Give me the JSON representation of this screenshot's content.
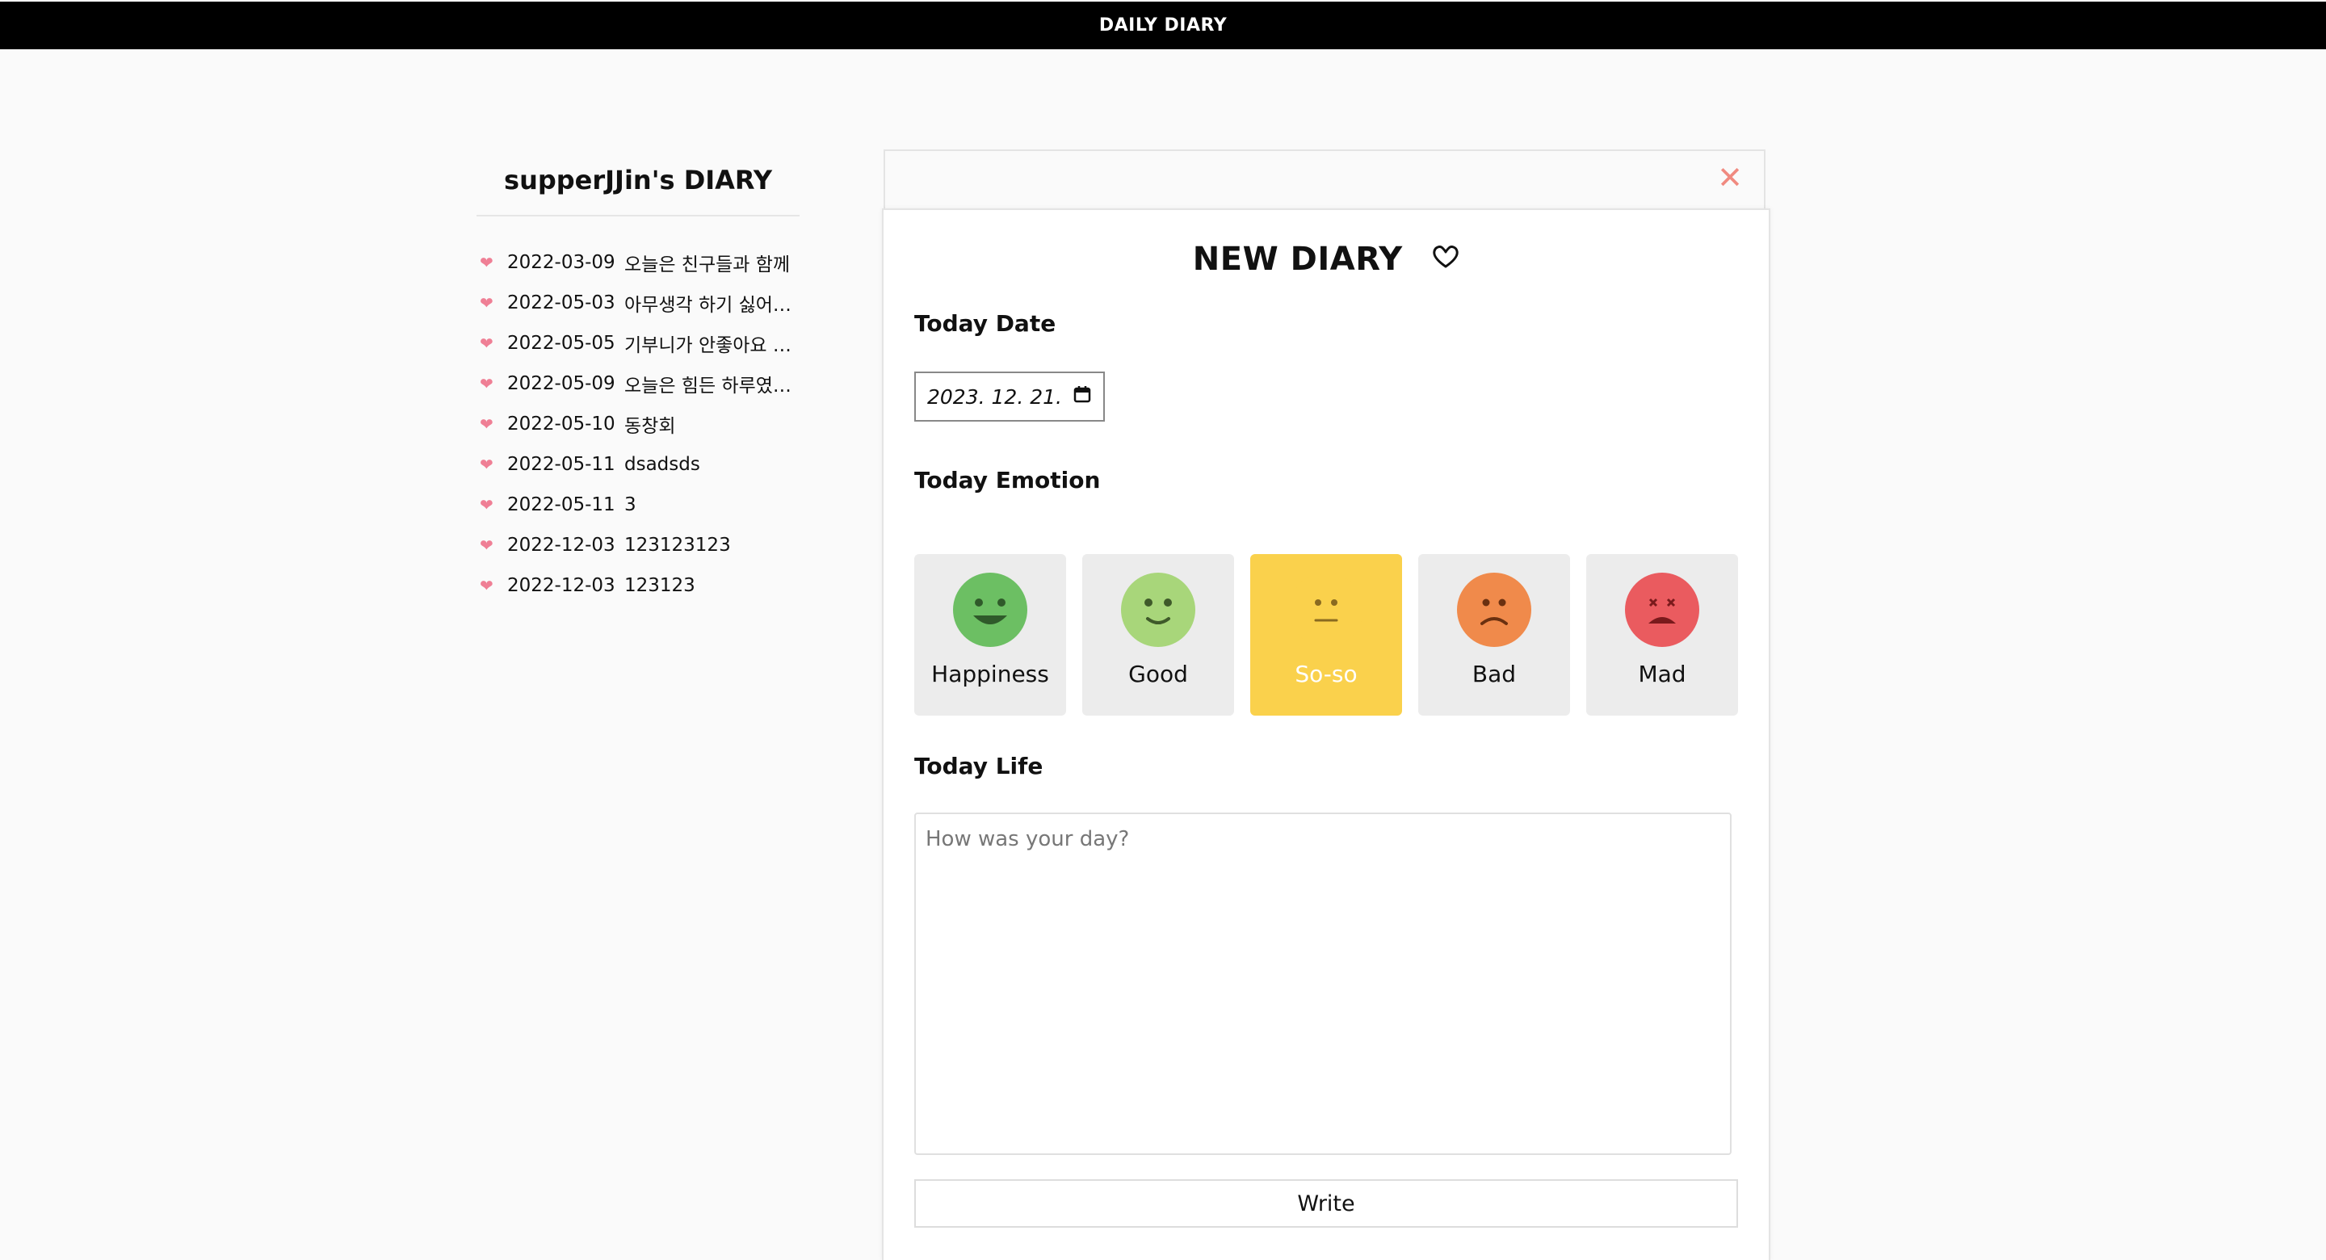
{
  "header": {
    "title": "DAILY DIARY"
  },
  "sidebar": {
    "title": "supperJJin's DIARY",
    "entries": [
      {
        "date": "2022-03-09",
        "text": "오늘은 친구들과 함께"
      },
      {
        "date": "2022-05-03",
        "text": "아무생각 하기 싫어…"
      },
      {
        "date": "2022-05-05",
        "text": "기부니가 안좋아요 …"
      },
      {
        "date": "2022-05-09",
        "text": "오늘은 힘든 하루였…"
      },
      {
        "date": "2022-05-10",
        "text": "동창회"
      },
      {
        "date": "2022-05-11",
        "text": "dsadsds"
      },
      {
        "date": "2022-05-11",
        "text": "3"
      },
      {
        "date": "2022-12-03",
        "text": "123123123"
      },
      {
        "date": "2022-12-03",
        "text": "123123"
      }
    ]
  },
  "modal": {
    "title": "NEW DIARY",
    "date_label": "Today Date",
    "date_value": "2023. 12. 21.",
    "emotion_label": "Today Emotion",
    "emotions": [
      {
        "label": "Happiness",
        "color": "#6cbf63"
      },
      {
        "label": "Good",
        "color": "#a8d67a"
      },
      {
        "label": "So-so",
        "color": "#fad14c",
        "selected": true
      },
      {
        "label": "Bad",
        "color": "#f08a4b"
      },
      {
        "label": "Mad",
        "color": "#ea5b5f"
      }
    ],
    "life_label": "Today Life",
    "life_placeholder": "How was your day?",
    "write_label": "Write"
  },
  "colors": {
    "accent_heart": "#ef7f95",
    "close": "#f08a80",
    "selected_emotion_bg": "#fad14c"
  }
}
